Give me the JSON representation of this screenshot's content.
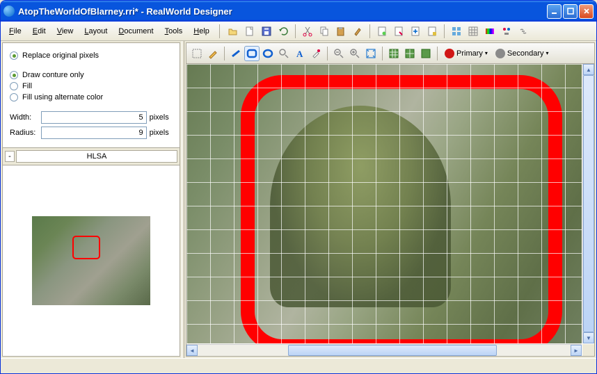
{
  "window": {
    "title": "AtopTheWorldOfBlarney.rri* - RealWorld Designer"
  },
  "menus": {
    "file": "File",
    "edit": "Edit",
    "view": "View",
    "layout": "Layout",
    "document": "Document",
    "tools": "Tools",
    "help": "Help"
  },
  "options": {
    "replace": "Replace original pixels",
    "contour": "Draw conture only",
    "fill": "Fill",
    "fillalt": "Fill using alternate color",
    "width_label": "Width:",
    "width_value": "5",
    "radius_label": "Radius:",
    "radius_value": "9",
    "unit": "pixels"
  },
  "hlsa_tab": "HLSA",
  "color": {
    "primary_label": "Primary",
    "secondary_label": "Secondary",
    "primary_hex": "#d01616",
    "secondary_hex": "#8a8a8a"
  },
  "toolbar_icons": {
    "open": "open-icon",
    "save": "save-icon",
    "save2": "save2-icon",
    "undo": "undo-icon",
    "cut": "cut-icon",
    "copy": "copy-icon",
    "paste": "paste-icon",
    "brush": "brush-icon",
    "doc1": "doc1-icon",
    "doc2": "doc2-icon",
    "doc3": "doc3-icon",
    "doc4": "doc4-icon",
    "grid1": "grid1-icon",
    "grid2": "grid2-icon",
    "color": "color-icon",
    "wizard": "wizard-icon",
    "link": "link-icon"
  },
  "canvas_tools": {
    "select": "select-icon",
    "pencil": "pencil-icon",
    "line": "line-icon",
    "rect": "rect-icon",
    "ellipse": "ellipse-icon",
    "magnify": "magnify-icon",
    "text": "text-icon",
    "picker": "picker-icon",
    "zoomout": "zoomout-icon",
    "zoomin": "zoomin-icon",
    "fit": "fit-icon",
    "g1": "grid-toggle-1",
    "g2": "grid-toggle-2",
    "g3": "grid-toggle-3"
  }
}
